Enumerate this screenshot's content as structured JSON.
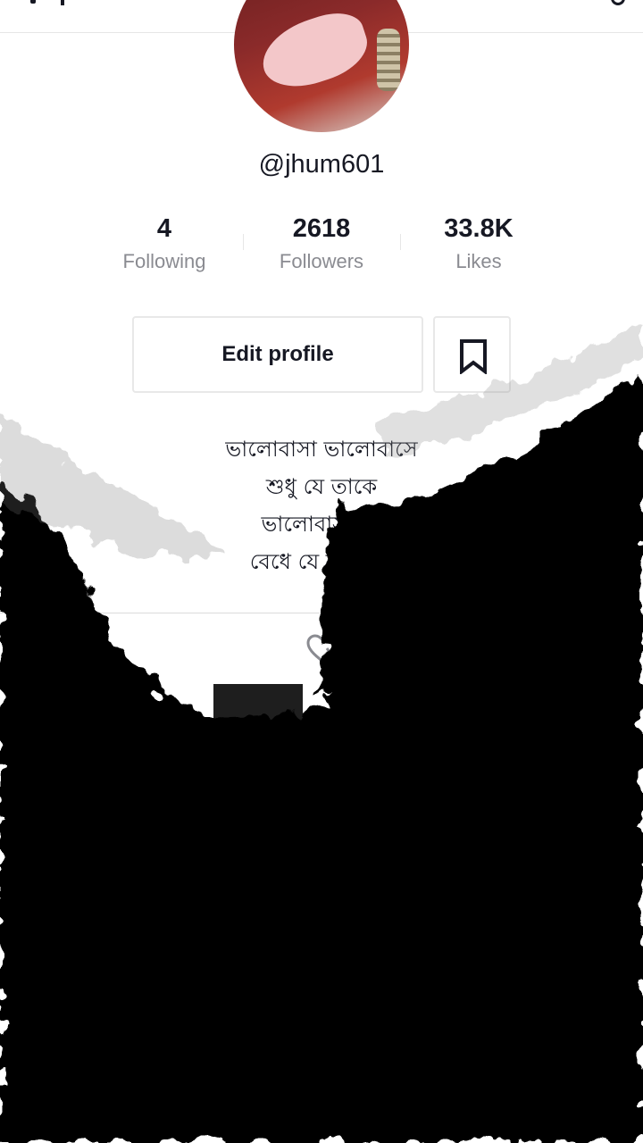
{
  "profile": {
    "username": "@jhum601",
    "stats": [
      {
        "value": "4",
        "label": "Following"
      },
      {
        "value": "2618",
        "label": "Followers"
      },
      {
        "value": "33.8K",
        "label": "Likes"
      }
    ],
    "edit_button": "Edit profile",
    "bio": "ভালোবাসা ভালোবাসে\nশুধু যে তাকে\nভালোবাসা ভা\nবেধে যে রাখে😘"
  },
  "icons": {
    "bookmark": "bookmark-icon",
    "liked_tab": "liked-videos-icon"
  },
  "colors": {
    "text": "#161823",
    "secondary": "#8a8b91",
    "border": "#e8e8e8"
  }
}
